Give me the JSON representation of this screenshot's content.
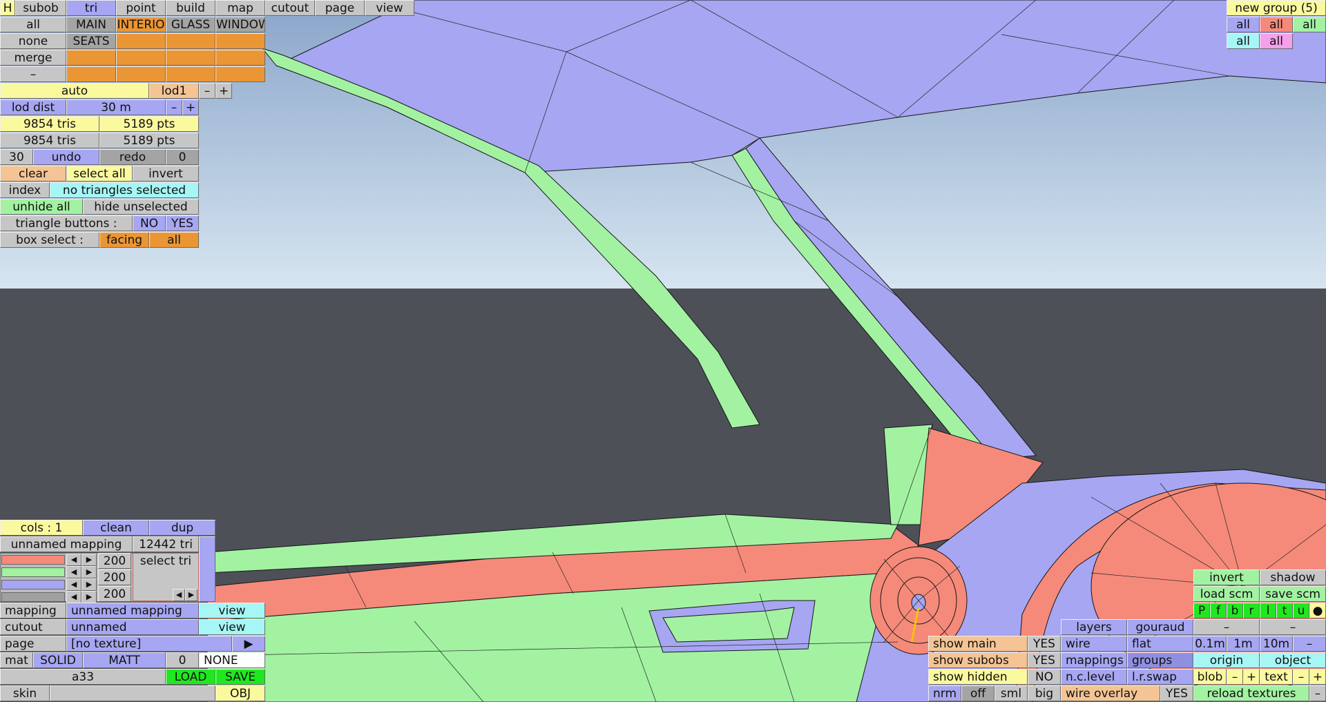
{
  "top_tabs": {
    "h": "H",
    "subob": "subob",
    "tri": "tri",
    "point": "point",
    "build": "build",
    "map": "map",
    "cutout": "cutout",
    "page": "page",
    "view": "view"
  },
  "sel_rows": {
    "all": "all",
    "main": "MAIN",
    "interio": "INTERIO",
    "glass": "GLASS",
    "windows": "WINDOWS",
    "none": "none",
    "seats": "SEATS",
    "merge": "merge",
    "minus": "–"
  },
  "lod": {
    "auto": "auto",
    "lod1": "lod1",
    "minus": "–",
    "plus": "+",
    "dist_label": "lod dist",
    "dist_value": "30 m"
  },
  "stats": {
    "tris1": "9854 tris",
    "pts1": "5189 pts",
    "tris2": "9854 tris",
    "pts2": "5189 pts"
  },
  "history": {
    "undo_count": "30",
    "undo": "undo",
    "redo": "redo",
    "redo_count": "0"
  },
  "selection": {
    "clear": "clear",
    "select_all": "select all",
    "invert": "invert",
    "index": "index",
    "status": "no triangles selected",
    "unhide_all": "unhide all",
    "hide_unselected": "hide unselected",
    "tri_buttons_label": "triangle buttons :",
    "no": "NO",
    "yes": "YES",
    "box_select_label": "box select :",
    "facing": "facing",
    "all": "all"
  },
  "groups": {
    "title": "new group (5)",
    "all": "all"
  },
  "mapping_panel": {
    "cols": "cols : 1",
    "clean": "clean",
    "dup": "dup",
    "mapping_name": "unnamed mapping",
    "tri_count": "12442 tri",
    "v1": "200",
    "v2": "200",
    "v3": "200",
    "select_tri": "select tri",
    "arrow_l": "◀",
    "arrow_r": "▶"
  },
  "bottom_left": {
    "mapping_label": "mapping",
    "mapping_value": "unnamed mapping",
    "view": "view",
    "cutout_label": "cutout",
    "cutout_value": "unnamed",
    "page_label": "page",
    "page_value": "[no texture]",
    "page_arrow": "▶",
    "mat": "mat",
    "solid": "SOLID",
    "matt": "MATT",
    "mat_num": "0",
    "none": "NONE",
    "file": "a33",
    "load": "LOAD",
    "save": "SAVE",
    "skin": "skin",
    "obj": "OBJ"
  },
  "bottom_right": {
    "invert": "invert",
    "shadow": "shadow",
    "load_scm": "load scm",
    "save_scm": "save scm",
    "views": [
      "P",
      "f",
      "b",
      "r",
      "l",
      "t",
      "u",
      "●"
    ],
    "layers": "layers",
    "gouraud": "gouraud",
    "dash": "–",
    "show_main": "show main",
    "show_main_v": "YES",
    "wire": "wire",
    "flat": "flat",
    "s01": "0.1m",
    "s1": "1m",
    "s10": "10m",
    "show_subobs": "show subobs",
    "show_subobs_v": "YES",
    "mappings": "mappings",
    "groups": "groups",
    "origin": "origin",
    "object": "object",
    "show_hidden": "show hidden",
    "show_hidden_v": "NO",
    "nc_level": "n.c.level",
    "lr_swap": "l.r.swap",
    "blob": "blob",
    "minus": "–",
    "plus": "+",
    "text": "text",
    "nrm": "nrm",
    "off": "off",
    "sml": "sml",
    "big": "big",
    "wire_overlay": "wire overlay",
    "wire_overlay_v": "YES",
    "reload_textures": "reload textures"
  },
  "colors": {
    "sky_top": "#8fa9cc",
    "sky_bottom": "#d4e4f0",
    "ground": "#4e5058",
    "mesh_blue": "#a6a6f2",
    "mesh_green": "#a2f2a2",
    "mesh_red": "#f58a7a"
  }
}
